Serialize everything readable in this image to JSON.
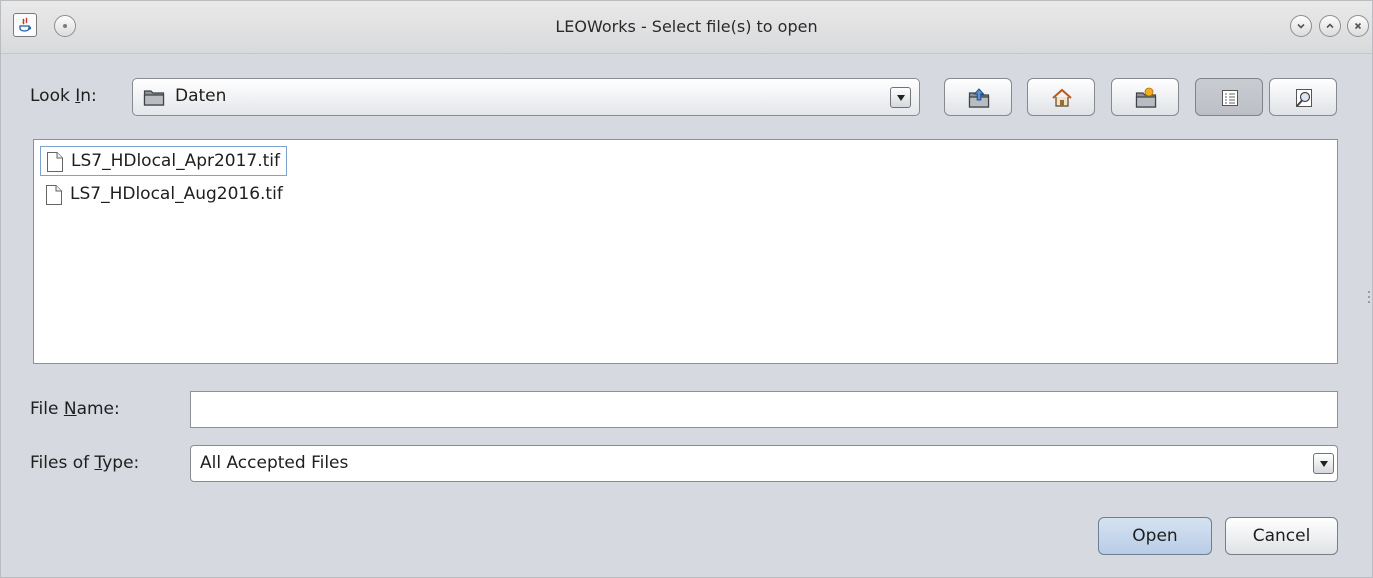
{
  "window": {
    "title": "LEOWorks - Select file(s) to open"
  },
  "titlebar_icons": {
    "app": "java-icon",
    "menu": "circle-menu-icon",
    "minimize": "minimize-icon",
    "maximize": "maximize-icon",
    "close": "close-icon"
  },
  "look_in": {
    "label_pre": "Look ",
    "label_mnemonic": "I",
    "label_post": "n:",
    "value": "Daten",
    "icon": "folder-icon"
  },
  "toolbar": {
    "buttons": [
      "up-folder-icon",
      "home-icon",
      "new-folder-icon",
      "list-view-icon",
      "details-view-icon"
    ],
    "pressed": "list-view-icon"
  },
  "files": [
    {
      "name": "LS7_HDlocal_Apr2017.tif",
      "selected": true
    },
    {
      "name": "LS7_HDlocal_Aug2016.tif",
      "selected": false
    }
  ],
  "file_name": {
    "label_pre": "File ",
    "label_mnemonic": "N",
    "label_post": "ame:",
    "value": ""
  },
  "files_of_type": {
    "label_pre": "Files of ",
    "label_mnemonic": "T",
    "label_post": "ype:",
    "value": "All Accepted Files"
  },
  "buttons": {
    "open": "Open",
    "cancel": "Cancel"
  }
}
